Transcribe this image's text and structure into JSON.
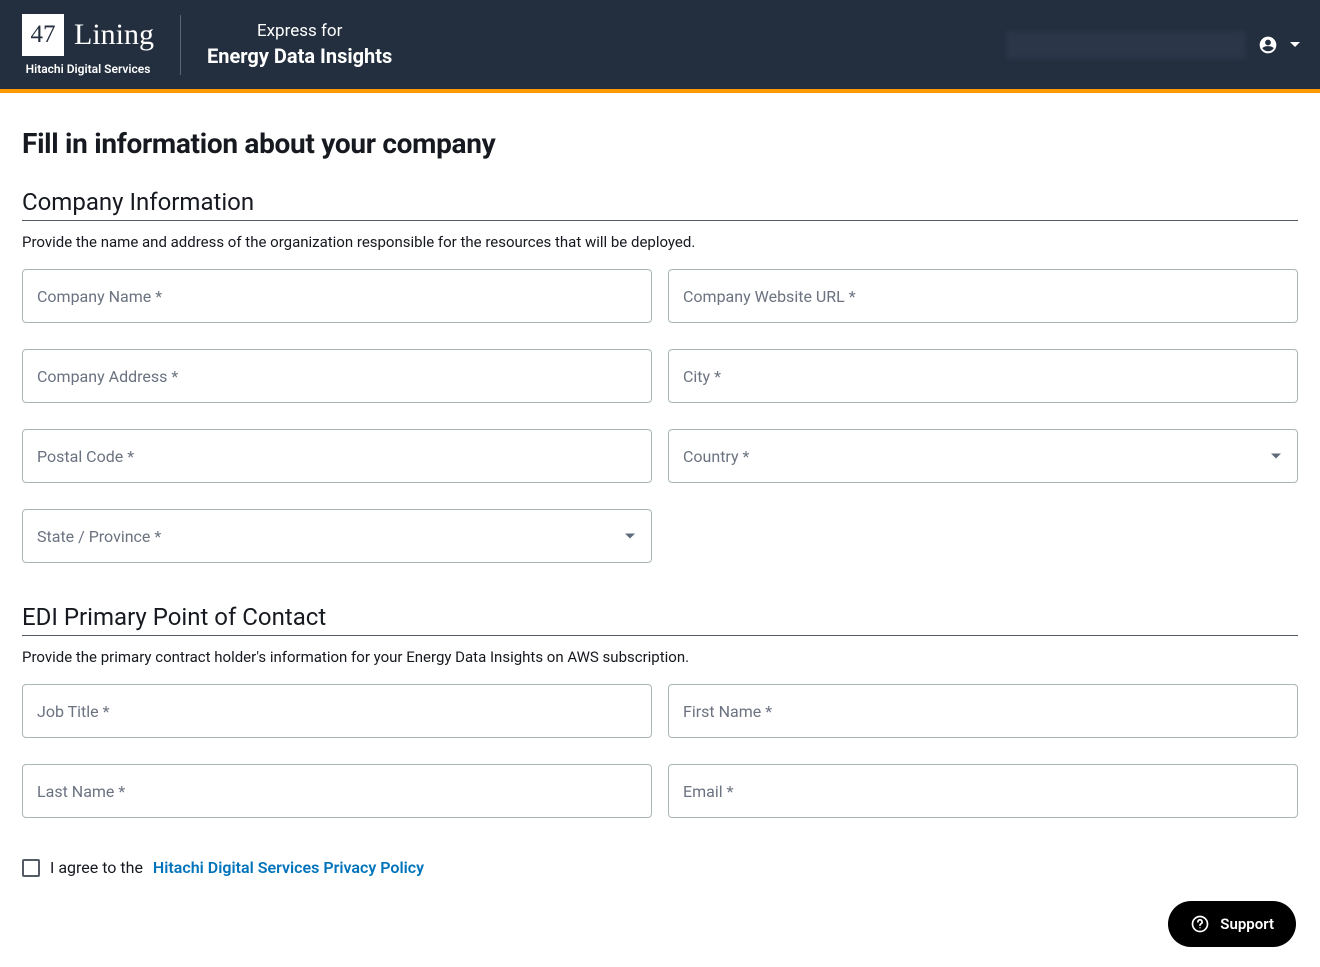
{
  "header": {
    "logo_number": "47",
    "logo_text": "Lining",
    "logo_sub": "Hitachi Digital Services",
    "product_top": "Express for",
    "product_bottom": "Energy Data Insights"
  },
  "page": {
    "title": "Fill in information about your company"
  },
  "section_company": {
    "title": "Company Information",
    "desc": "Provide the name and address of the organization responsible for the resources that will be deployed.",
    "fields": {
      "company_name": "Company Name *",
      "company_website": "Company Website URL *",
      "company_address": "Company Address *",
      "city": "City *",
      "postal_code": "Postal Code *",
      "country": "Country *",
      "state": "State / Province *"
    }
  },
  "section_contact": {
    "title": "EDI Primary Point of Contact",
    "desc": "Provide the primary contract holder's information for your Energy Data Insights on AWS subscription.",
    "fields": {
      "job_title": "Job Title *",
      "first_name": "First Name *",
      "last_name": "Last Name *",
      "email": "Email *"
    }
  },
  "consent": {
    "text": "I agree to the ",
    "link": "Hitachi Digital Services Privacy Policy"
  },
  "support": {
    "label": "Support"
  }
}
